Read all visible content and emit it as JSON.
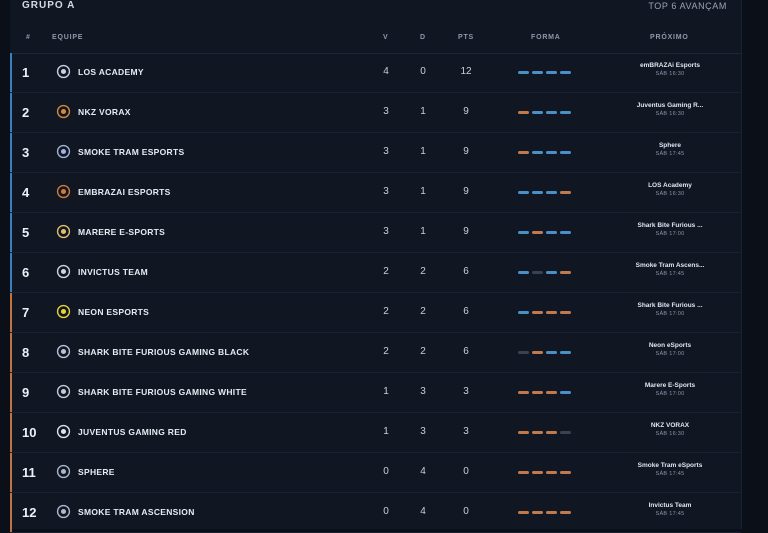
{
  "group": {
    "title": "GRUPO A",
    "subtitle": "TOP 6 AVANÇAM"
  },
  "headers": {
    "pos": "#",
    "team": "EQUIPE",
    "wins": "V",
    "losses": "D",
    "points": "PTS",
    "form": "FORMA",
    "next": "PRÓXIMO"
  },
  "colors": {
    "win": "#4b8fc7",
    "loss": "#c17a4e",
    "none": "#3a4150",
    "advance": "#3c7fbf",
    "eliminate": "#c07345"
  },
  "rows": [
    {
      "pos": "1",
      "team": "LOS ACADEMY",
      "icon": "los-academy-logo-icon",
      "v": "4",
      "d": "0",
      "pts": "12",
      "form": [
        "win",
        "win",
        "win",
        "win"
      ],
      "next_team": "emBRAZAi Esports",
      "next_time": "SÁB 16:30",
      "zone": "advance"
    },
    {
      "pos": "2",
      "team": "NKZ VORAX",
      "icon": "nkz-vorax-logo-icon",
      "v": "3",
      "d": "1",
      "pts": "9",
      "form": [
        "loss",
        "win",
        "win",
        "win"
      ],
      "next_team": "Juventus Gaming R...",
      "next_time": "SÁB 16:30",
      "zone": "advance"
    },
    {
      "pos": "3",
      "team": "SMOKE TRAM ESPORTS",
      "icon": "smoke-tram-logo-icon",
      "v": "3",
      "d": "1",
      "pts": "9",
      "form": [
        "loss",
        "win",
        "win",
        "win"
      ],
      "next_team": "Sphere",
      "next_time": "SÁB 17:45",
      "zone": "advance"
    },
    {
      "pos": "4",
      "team": "EMBRAZAI ESPORTS",
      "icon": "embrazai-logo-icon",
      "v": "3",
      "d": "1",
      "pts": "9",
      "form": [
        "win",
        "win",
        "win",
        "loss"
      ],
      "next_team": "LOS Academy",
      "next_time": "SÁB 16:30",
      "zone": "advance"
    },
    {
      "pos": "5",
      "team": "MARERE E-SPORTS",
      "icon": "marere-logo-icon",
      "v": "3",
      "d": "1",
      "pts": "9",
      "form": [
        "win",
        "loss",
        "win",
        "win"
      ],
      "next_team": "Shark Bite Furious ...",
      "next_time": "SÁB 17:00",
      "zone": "advance"
    },
    {
      "pos": "6",
      "team": "INVICTUS TEAM",
      "icon": "invictus-logo-icon",
      "v": "2",
      "d": "2",
      "pts": "6",
      "form": [
        "win",
        "none",
        "win",
        "loss"
      ],
      "next_team": "Smoke Tram Ascens...",
      "next_time": "SÁB 17:45",
      "zone": "advance"
    },
    {
      "pos": "7",
      "team": "NEON ESPORTS",
      "icon": "neon-logo-icon",
      "v": "2",
      "d": "2",
      "pts": "6",
      "form": [
        "win",
        "loss",
        "loss",
        "loss"
      ],
      "next_team": "Shark Bite Furious ...",
      "next_time": "SÁB 17:00",
      "zone": "eliminate"
    },
    {
      "pos": "8",
      "team": "SHARK BITE FURIOUS GAMING BLACK",
      "icon": "shark-bite-logo-icon",
      "v": "2",
      "d": "2",
      "pts": "6",
      "form": [
        "none",
        "loss",
        "win",
        "win"
      ],
      "next_team": "Neon eSports",
      "next_time": "SÁB 17:00",
      "zone": "eliminate"
    },
    {
      "pos": "9",
      "team": "SHARK BITE FURIOUS GAMING WHITE",
      "icon": "shark-bite-white-logo-icon",
      "v": "1",
      "d": "3",
      "pts": "3",
      "form": [
        "loss",
        "loss",
        "loss",
        "win"
      ],
      "next_team": "Marere E-Sports",
      "next_time": "SÁB 17:00",
      "zone": "eliminate"
    },
    {
      "pos": "10",
      "team": "JUVENTUS GAMING RED",
      "icon": "juventus-logo-icon",
      "v": "1",
      "d": "3",
      "pts": "3",
      "form": [
        "loss",
        "loss",
        "loss",
        "none"
      ],
      "next_team": "NKZ VORAX",
      "next_time": "SÁB 16:30",
      "zone": "eliminate"
    },
    {
      "pos": "11",
      "team": "SPHERE",
      "icon": "sphere-logo-icon",
      "v": "0",
      "d": "4",
      "pts": "0",
      "form": [
        "loss",
        "loss",
        "loss",
        "loss"
      ],
      "next_team": "Smoke Tram eSports",
      "next_time": "SÁB 17:45",
      "zone": "eliminate"
    },
    {
      "pos": "12",
      "team": "SMOKE TRAM ASCENSION",
      "icon": "smoke-tram-ascension-logo-icon",
      "v": "0",
      "d": "4",
      "pts": "0",
      "form": [
        "loss",
        "loss",
        "loss",
        "loss"
      ],
      "next_team": "Invictus Team",
      "next_time": "SÁB 17:45",
      "zone": "eliminate"
    }
  ]
}
